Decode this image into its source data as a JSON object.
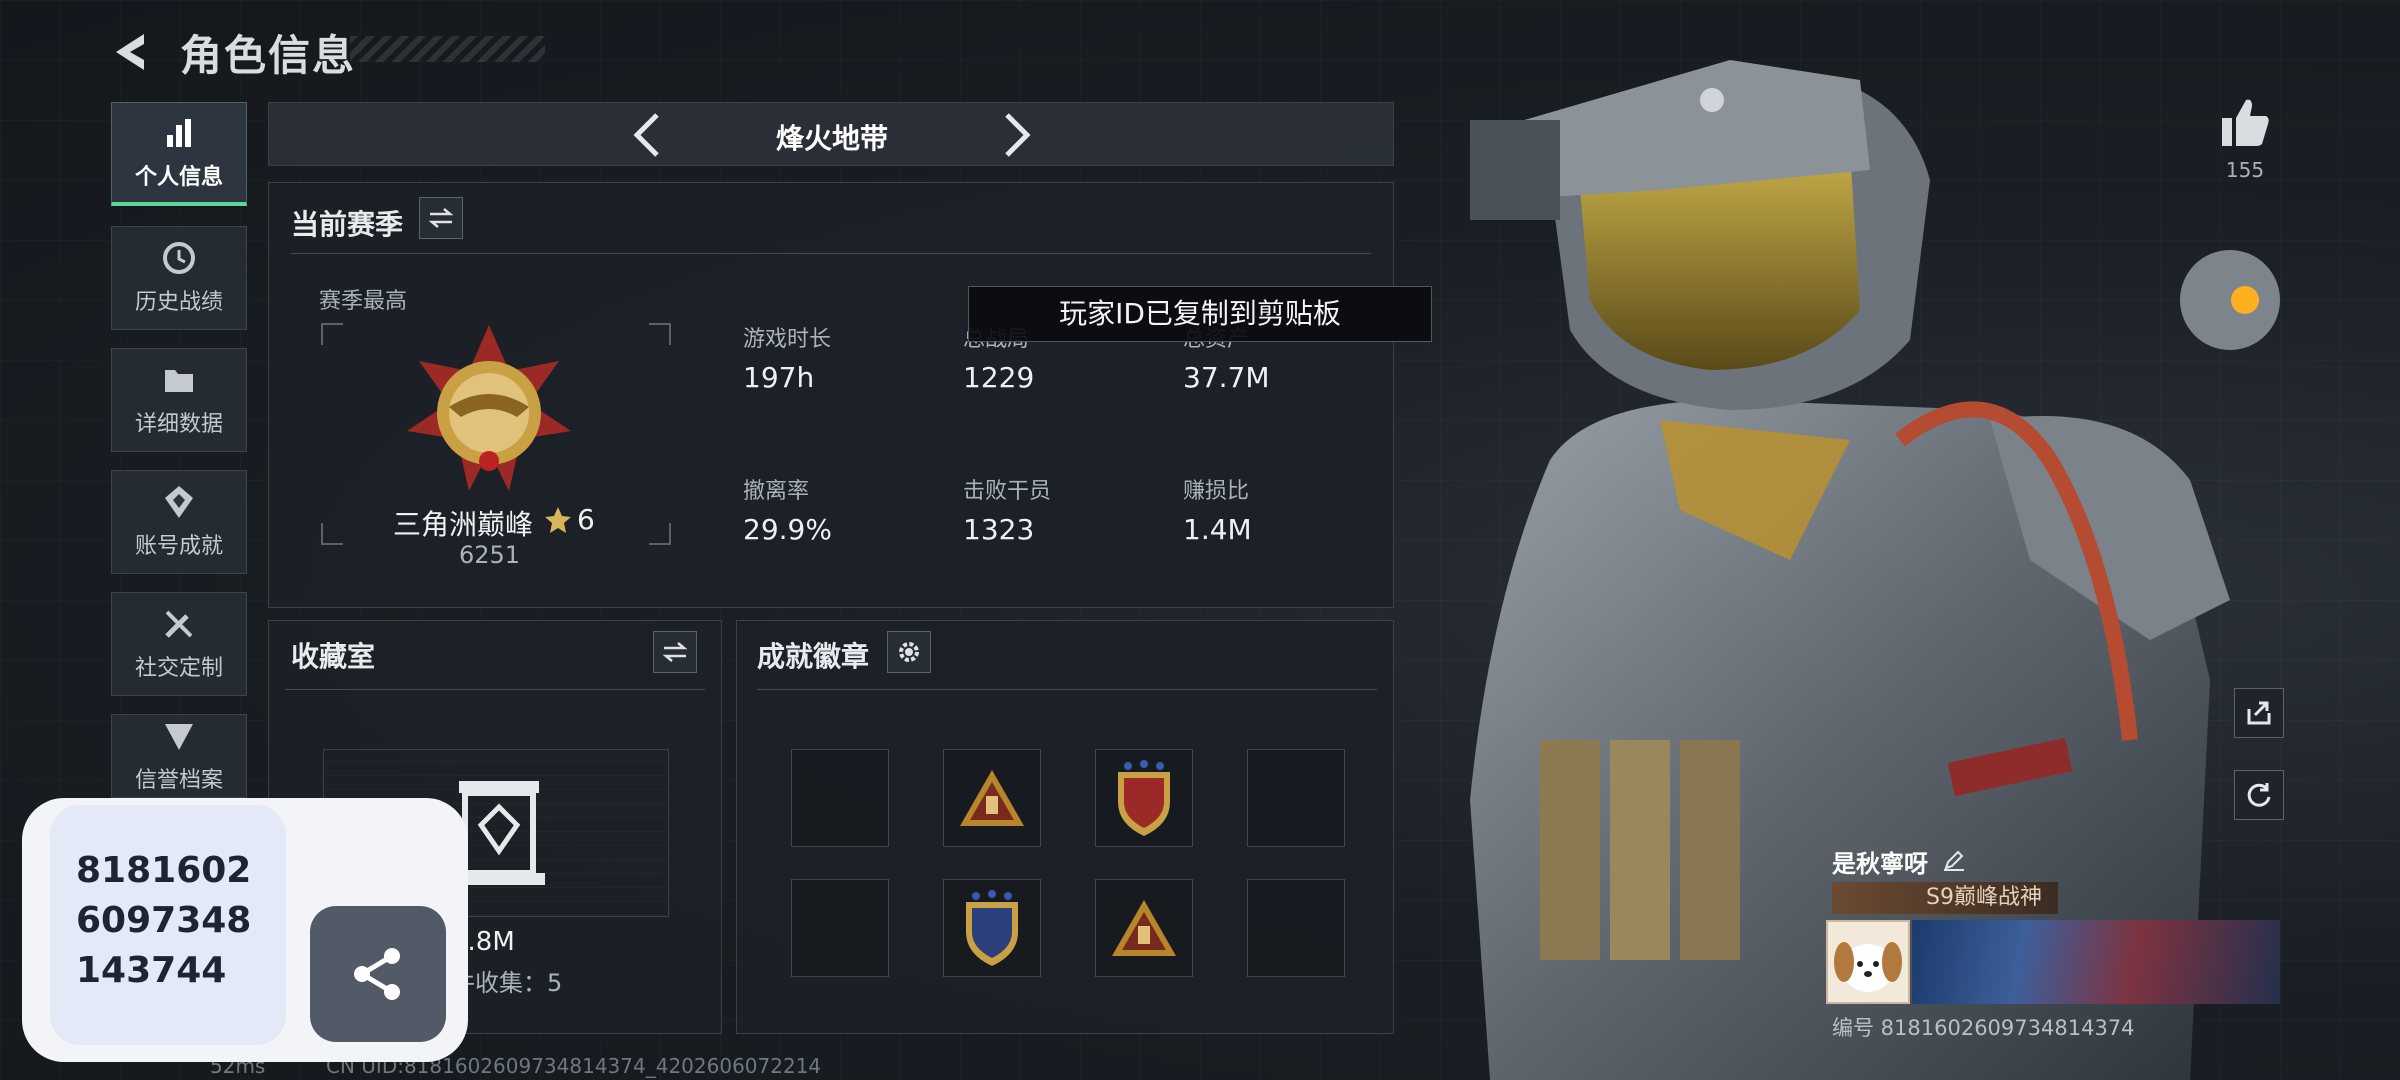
{
  "header": {
    "title": "角色信息"
  },
  "sidebar": {
    "items": [
      {
        "label": "个人信息",
        "icon": "bar-chart-icon",
        "active": true
      },
      {
        "label": "历史战绩",
        "icon": "history-clock-icon"
      },
      {
        "label": "详细数据",
        "icon": "folder-icon"
      },
      {
        "label": "账号成就",
        "icon": "achievement-icon"
      },
      {
        "label": "社交定制",
        "icon": "tools-icon"
      },
      {
        "label": "信誉档案",
        "icon": "shield-icon"
      }
    ]
  },
  "mode_selector": {
    "name": "烽火地带"
  },
  "season": {
    "title": "当前赛季",
    "best_label": "赛季最高",
    "rank_name": "三角洲巅峰",
    "rank_stars": "6",
    "rank_score": "6251",
    "stats": [
      {
        "label": "游戏时长",
        "value": "197h"
      },
      {
        "label": "总战局",
        "value": "1229"
      },
      {
        "label": "总资产",
        "value": "37.7M"
      },
      {
        "label": "撤离率",
        "value": "29.9%"
      },
      {
        "label": "击败干员",
        "value": "1323"
      },
      {
        "label": "赚损比",
        "value": "1.4M"
      }
    ]
  },
  "toast": {
    "text": "玩家ID已复制到剪贴板"
  },
  "collection": {
    "title": "收藏室",
    "value": "7.8M",
    "collected_text": "件收集：5"
  },
  "badges": {
    "title": "成就徽章"
  },
  "likes": {
    "count": "155"
  },
  "player": {
    "name": "是秋寧呀",
    "title_tag": "S9巅峰战神",
    "id_text": "编号 8181602609734814374"
  },
  "popup": {
    "number_text": "8181602\n6097348\n143744"
  },
  "status_bar": {
    "ping": "52ms",
    "uid_line": "CN UID:8181602609734814374_4202606072214"
  },
  "colors": {
    "accent": "#5fd693",
    "panel": "#1c2128",
    "gold": "#c9a043"
  }
}
